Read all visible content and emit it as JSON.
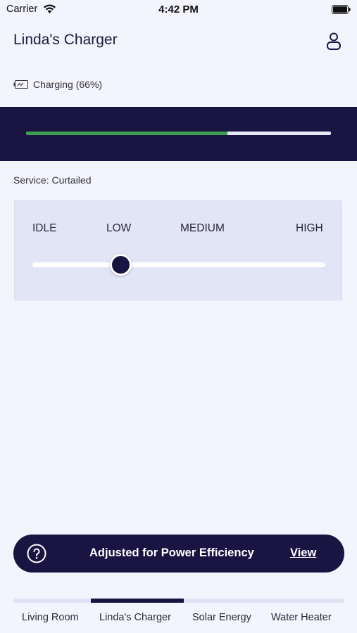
{
  "status_bar": {
    "carrier": "Carrier",
    "time": "4:42 PM"
  },
  "header": {
    "title": "Linda's Charger",
    "profile_icon": "person-icon"
  },
  "charging": {
    "icon": "battery-charging-icon",
    "status_text": "Charging (66%)",
    "progress_fraction": 0.66,
    "progress_color": "#3aa14e"
  },
  "service": {
    "status_text": "Service: Curtailed"
  },
  "power_level": {
    "options": [
      "IDLE",
      "LOW",
      "MEDIUM",
      "HIGH"
    ],
    "selected": "LOW",
    "selected_index": 1
  },
  "banner": {
    "icon": "question-circle-icon",
    "message": "Adjusted for Power Efficiency",
    "action_label": "View"
  },
  "tabs": {
    "items": [
      {
        "label": "Living Room",
        "active": false
      },
      {
        "label": "Linda's Charger",
        "active": true
      },
      {
        "label": "Solar Energy",
        "active": false
      },
      {
        "label": "Water Heater",
        "active": false
      }
    ]
  },
  "colors": {
    "brand_dark": "#1a1443",
    "background": "#f3f4fd",
    "card": "#e1e5f6",
    "progress_green": "#3aa14e"
  }
}
